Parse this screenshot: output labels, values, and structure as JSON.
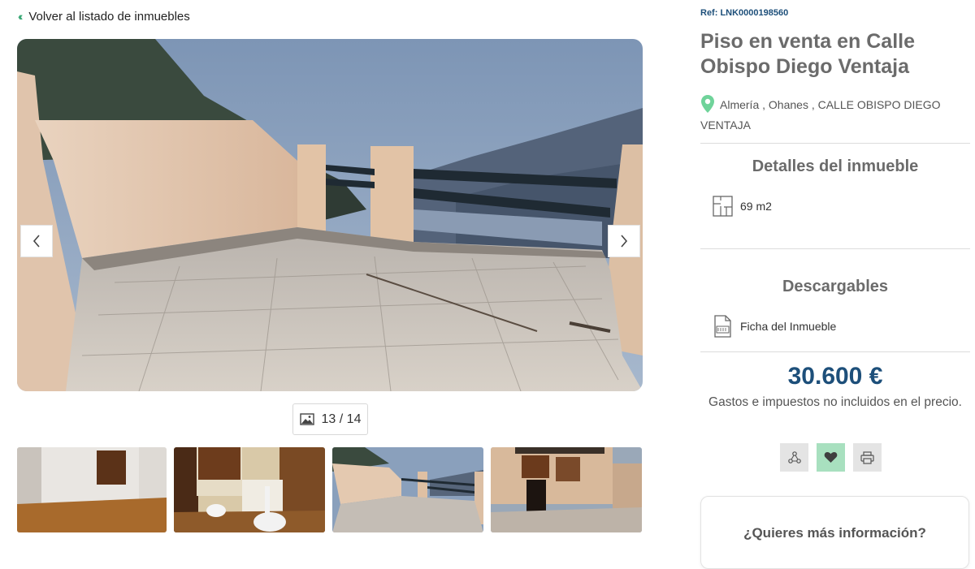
{
  "back_link": {
    "label": "Volver al listado de inmuebles"
  },
  "gallery": {
    "counter": "13 / 14",
    "thumbnails": [
      "thumb-room",
      "thumb-bathroom",
      "thumb-terrace",
      "thumb-patio"
    ]
  },
  "property": {
    "ref": "Ref: LNK0000198560",
    "title": "Piso en venta en Calle Obispo Diego Ventaja",
    "address": "Almería , Ohanes , CALLE OBISPO DIEGO VENTAJA"
  },
  "details": {
    "heading": "Detalles del inmueble",
    "area": "69 m2"
  },
  "downloads": {
    "heading": "Descargables",
    "file_label": "Ficha del Inmueble"
  },
  "price": {
    "amount": "30.600 €",
    "note": "Gastos e impuestos no incluidos en el precio."
  },
  "actions": {
    "share_icon": "share-icon",
    "favorite_icon": "heart-icon",
    "print_icon": "printer-icon"
  },
  "contact": {
    "heading": "¿Quieres más información?"
  },
  "colors": {
    "brand_blue": "#1d4f7a",
    "accent_green": "#3aa876",
    "favorite_bg": "#a8e0bf"
  }
}
